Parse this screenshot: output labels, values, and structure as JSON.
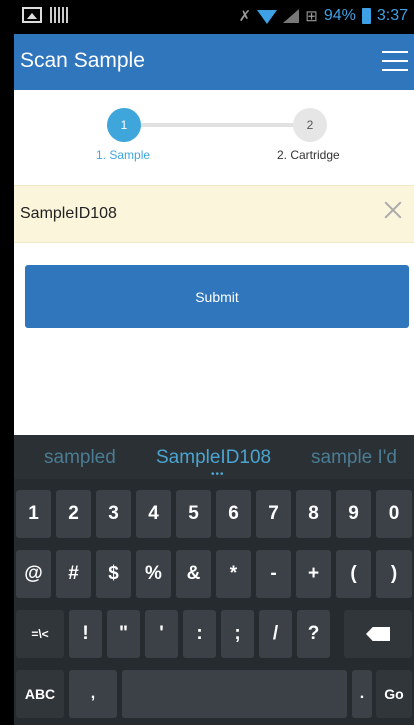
{
  "status_bar": {
    "battery_percent": "94%",
    "time": "3:37"
  },
  "app_bar": {
    "title": "Scan Sample"
  },
  "stepper": {
    "steps": [
      {
        "number": "1",
        "label": "1. Sample",
        "active": true
      },
      {
        "number": "2",
        "label": "2. Cartridge",
        "active": false
      }
    ]
  },
  "sample_field": {
    "value": "SampleID108"
  },
  "submit": {
    "label": "Submit"
  },
  "keyboard": {
    "suggestions": [
      "sampled",
      "SampleID108",
      "sample I'd"
    ],
    "suggestion_dots": "•••",
    "rows": [
      [
        "1",
        "2",
        "3",
        "4",
        "5",
        "6",
        "7",
        "8",
        "9",
        "0"
      ],
      [
        "@",
        "#",
        "$",
        "%",
        "&",
        "*",
        "-",
        "+",
        "(",
        ")"
      ],
      [
        "=\\<",
        "!",
        "\"",
        "'",
        ":",
        ";",
        "/",
        "?",
        "backspace"
      ],
      [
        "ABC",
        ",",
        "space",
        ".",
        "Go"
      ]
    ],
    "labels": {
      "symbols_toggle": "=\\<",
      "abc_toggle": "ABC",
      "comma": ",",
      "period": ".",
      "go": "Go"
    }
  },
  "colors": {
    "app_bar": "#2f76bd",
    "active_step": "#3fa6dc",
    "input_background": "#fbf5dc",
    "keyboard_background": "#262b30"
  }
}
